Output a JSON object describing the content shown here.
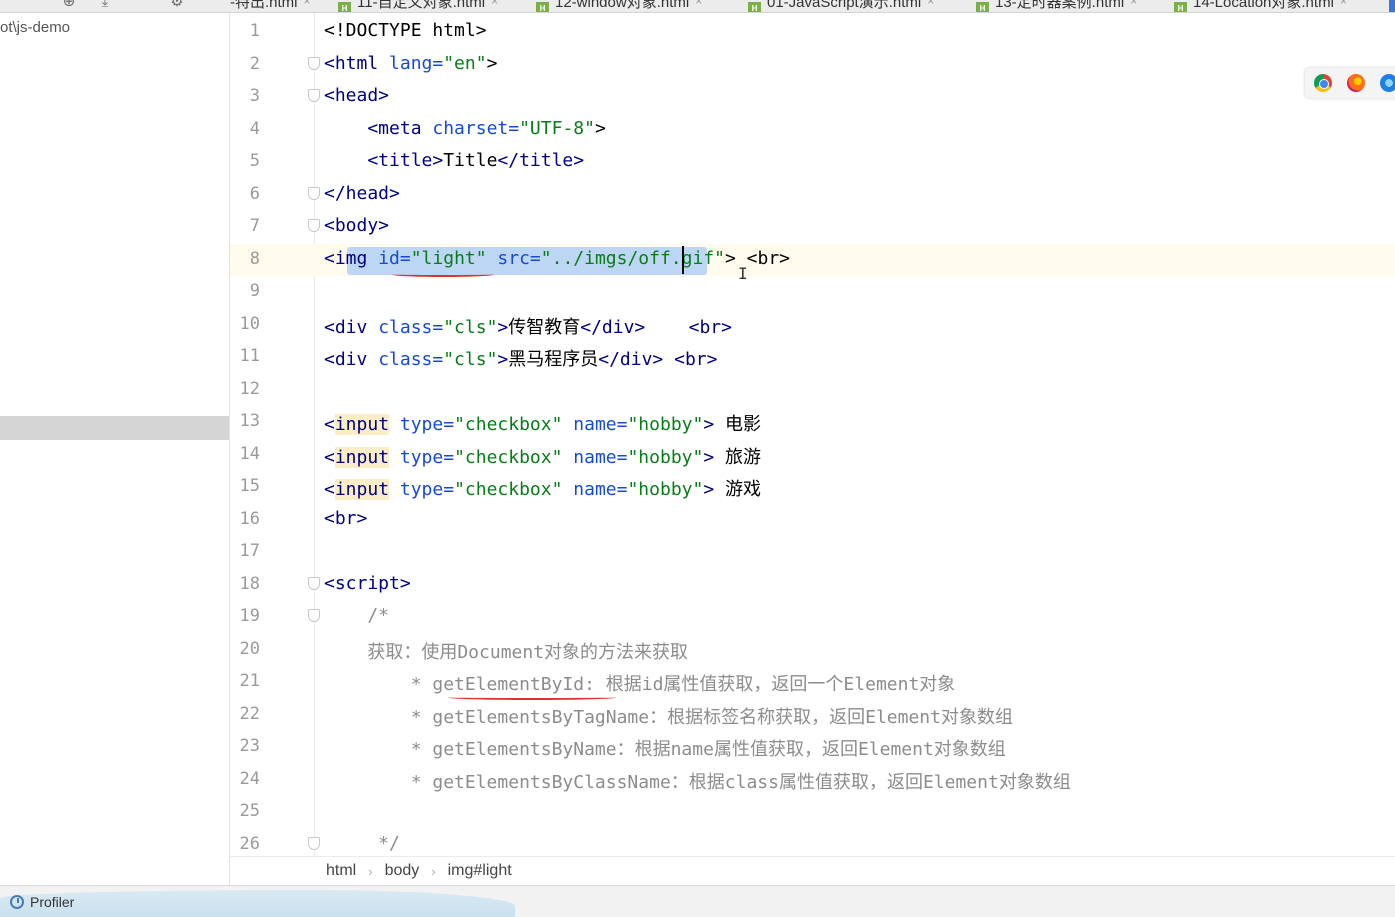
{
  "tabs": [
    {
      "label": "-特出.html"
    },
    {
      "label": "11-自定义对象.html"
    },
    {
      "label": "12-window对象.html"
    },
    {
      "label": "01-JavaScript演示.html"
    },
    {
      "label": "13-定时器案例.html"
    },
    {
      "label": "14-Location对象.html"
    }
  ],
  "project": {
    "path": "ot\\js-demo"
  },
  "lines": [
    {
      "n": "1"
    },
    {
      "n": "2"
    },
    {
      "n": "3"
    },
    {
      "n": "4"
    },
    {
      "n": "5"
    },
    {
      "n": "6"
    },
    {
      "n": "7"
    },
    {
      "n": "8"
    },
    {
      "n": "9"
    },
    {
      "n": "10"
    },
    {
      "n": "11"
    },
    {
      "n": "12"
    },
    {
      "n": "13"
    },
    {
      "n": "14"
    },
    {
      "n": "15"
    },
    {
      "n": "16"
    },
    {
      "n": "17"
    },
    {
      "n": "18"
    },
    {
      "n": "19"
    },
    {
      "n": "20"
    },
    {
      "n": "21"
    },
    {
      "n": "22"
    },
    {
      "n": "23"
    },
    {
      "n": "24"
    },
    {
      "n": "25"
    },
    {
      "n": "26"
    }
  ],
  "code": {
    "l1": "<!DOCTYPE html>",
    "l2_tag": "<html",
    "l2_attr": " lang=",
    "l2_val": "\"en\"",
    "l2_end": ">",
    "l3": "<head>",
    "l4_tag": "    <meta",
    "l4_attr": " charset=",
    "l4_val": "\"UTF-8\"",
    "l4_end": ">",
    "l5_open": "    <title>",
    "l5_text": "Title",
    "l5_close": "</title>",
    "l6": "</head>",
    "l7": "<body>",
    "l8_tag": "<img",
    "l8_attr1": " id=",
    "l8_val1": "\"light\"",
    "l8_attr2": " src=",
    "l8_val2": "\"../imgs/off.gif\"",
    "l8_end": "> <br>",
    "l10_tag": "<div",
    "l10_attr": " class=",
    "l10_val": "\"cls\"",
    "l10_mid": ">",
    "l10_text": "传智教育",
    "l10_end": "</div>    <br>",
    "l11_tag": "<div",
    "l11_attr": " class=",
    "l11_val": "\"cls\"",
    "l11_mid": ">",
    "l11_text": "黑马程序员",
    "l11_end": "</div> <br>",
    "l13_lt": "<",
    "l13_tag": "input",
    "l13_attr1": " type=",
    "l13_val1": "\"checkbox\"",
    "l13_attr2": " name=",
    "l13_val2": "\"hobby\"",
    "l13_end": "> ",
    "l13_text": "电影",
    "l14_lt": "<",
    "l14_tag": "input",
    "l14_attr1": " type=",
    "l14_val1": "\"checkbox\"",
    "l14_attr2": " name=",
    "l14_val2": "\"hobby\"",
    "l14_end": "> ",
    "l14_text": "旅游",
    "l15_lt": "<",
    "l15_tag": "input",
    "l15_attr1": " type=",
    "l15_val1": "\"checkbox\"",
    "l15_attr2": " name=",
    "l15_val2": "\"hobby\"",
    "l15_end": "> ",
    "l15_text": "游戏",
    "l16": "<br>",
    "l18": "<script>",
    "l19": "    /*",
    "l20": "    获取：使用Document对象的方法来获取",
    "l21": "        * getElementById: 根据id属性值获取，返回一个Element对象",
    "l22": "        * getElementsByTagName：根据标签名称获取，返回Element对象数组",
    "l23": "        * getElementsByName：根据name属性值获取，返回Element对象数组",
    "l24": "        * getElementsByClassName：根据class属性值获取，返回Element对象数组",
    "l26": "     */"
  },
  "breadcrumb": [
    "html",
    "body",
    "img#light"
  ],
  "status": {
    "profiler": "Profiler"
  },
  "colors": {
    "selection": "#bdd6f3",
    "current_line": "#fefbec",
    "underline": "#e0312a"
  }
}
